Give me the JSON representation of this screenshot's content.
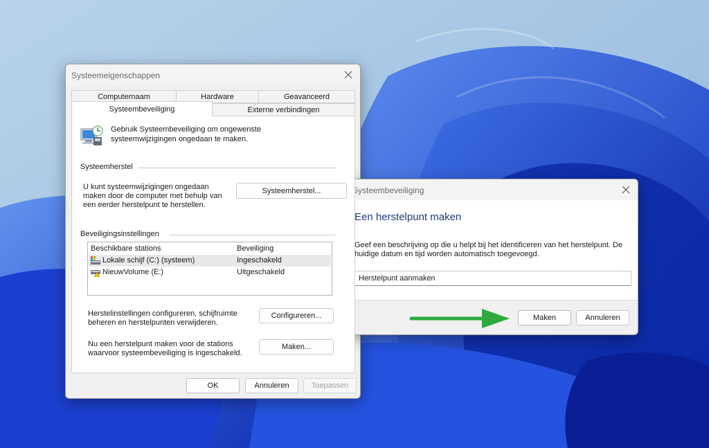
{
  "colors": {
    "accent_arrow": "#2eaa3c",
    "heading": "#1f3a78",
    "wallpaper": "#2f5fd8"
  },
  "properties_dialog": {
    "title": "Systeemeigenschappen",
    "close_icon": "close-icon",
    "tabs_row1": [
      "Computernaam",
      "Hardware",
      "Geavanceerd"
    ],
    "tabs_row2": [
      "Systeembeveiliging",
      "Externe verbindingen"
    ],
    "active_tab": "Systeembeveiliging",
    "intro_icon": "system-protection-icon",
    "intro_line1": "Gebruik Systeembeveiliging om ongewenste",
    "intro_line2": "systeemwijzigingen ongedaan te maken.",
    "restore_group": "Systeemherstel",
    "restore_text_line1": "U kunt systeemwijzigingen ongedaan",
    "restore_text_line2": "maken door de computer met behulp van",
    "restore_text_line3": "een eerder herstelpunt te herstellen.",
    "restore_button": "Systeemherstel...",
    "protection_group": "Beveiligingsinstellingen",
    "table_headers": [
      "Beschikbare stations",
      "Beveiliging"
    ],
    "drives": [
      {
        "name": "Lokale schijf (C:) (systeem)",
        "status": "Ingeschakeld",
        "icon": "system-drive-icon"
      },
      {
        "name": "NieuwVolume (E:)",
        "status": "Uitgeschakeld",
        "icon": "drive-warning-icon"
      }
    ],
    "configure_text_line1": "Herstelinstellingen configureren, schijfruimte",
    "configure_text_line2": "beheren en herstelpunten verwijderen.",
    "configure_button": "Configureren...",
    "create_text_line1": "Nu een herstelpunt maken voor de stations",
    "create_text_line2": "waarvoor systeembeveiliging is ingeschakeld.",
    "create_button": "Maken...",
    "ok_button": "OK",
    "cancel_button": "Annuleren",
    "apply_button": "Toepassen"
  },
  "create_dialog": {
    "title": "Systeembeveiliging",
    "close_icon": "close-icon",
    "heading": "Een herstelpunt maken",
    "description_line1": "Geef een beschrijving op die u helpt bij het identificeren van het herstelpunt. De",
    "description_line2": "huidige datum en tijd worden automatisch toegevoegd.",
    "input_value": "Herstelpunt aanmaken",
    "create_button": "Maken",
    "cancel_button": "Annuleren"
  },
  "annotations": {
    "arrow_icon": "green-arrow-icon"
  }
}
